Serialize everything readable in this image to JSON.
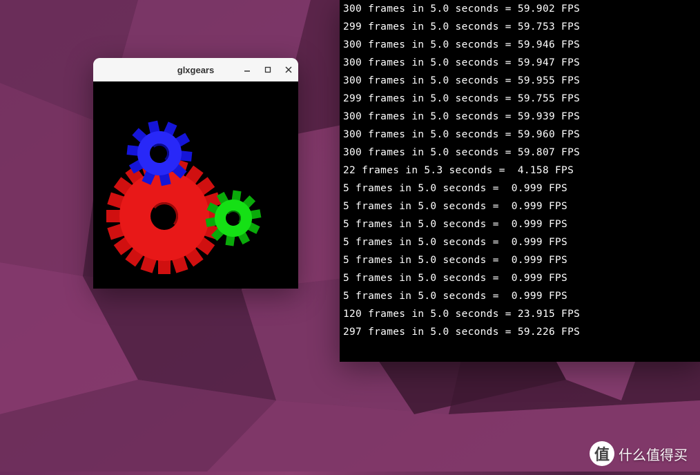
{
  "glxgears": {
    "title": "glxgears",
    "gears": [
      "blue-gear",
      "red-gear",
      "green-gear"
    ]
  },
  "terminal": {
    "lines": [
      "300 frames in 5.0 seconds = 59.902 FPS",
      "299 frames in 5.0 seconds = 59.753 FPS",
      "300 frames in 5.0 seconds = 59.946 FPS",
      "300 frames in 5.0 seconds = 59.947 FPS",
      "300 frames in 5.0 seconds = 59.955 FPS",
      "299 frames in 5.0 seconds = 59.755 FPS",
      "300 frames in 5.0 seconds = 59.939 FPS",
      "300 frames in 5.0 seconds = 59.960 FPS",
      "300 frames in 5.0 seconds = 59.807 FPS",
      "22 frames in 5.3 seconds =  4.158 FPS",
      "5 frames in 5.0 seconds =  0.999 FPS",
      "5 frames in 5.0 seconds =  0.999 FPS",
      "5 frames in 5.0 seconds =  0.999 FPS",
      "5 frames in 5.0 seconds =  0.999 FPS",
      "5 frames in 5.0 seconds =  0.999 FPS",
      "5 frames in 5.0 seconds =  0.999 FPS",
      "5 frames in 5.0 seconds =  0.999 FPS",
      "120 frames in 5.0 seconds = 23.915 FPS",
      "297 frames in 5.0 seconds = 59.226 FPS"
    ]
  },
  "watermark": {
    "circle_text": "值",
    "text": "什么值得买"
  }
}
